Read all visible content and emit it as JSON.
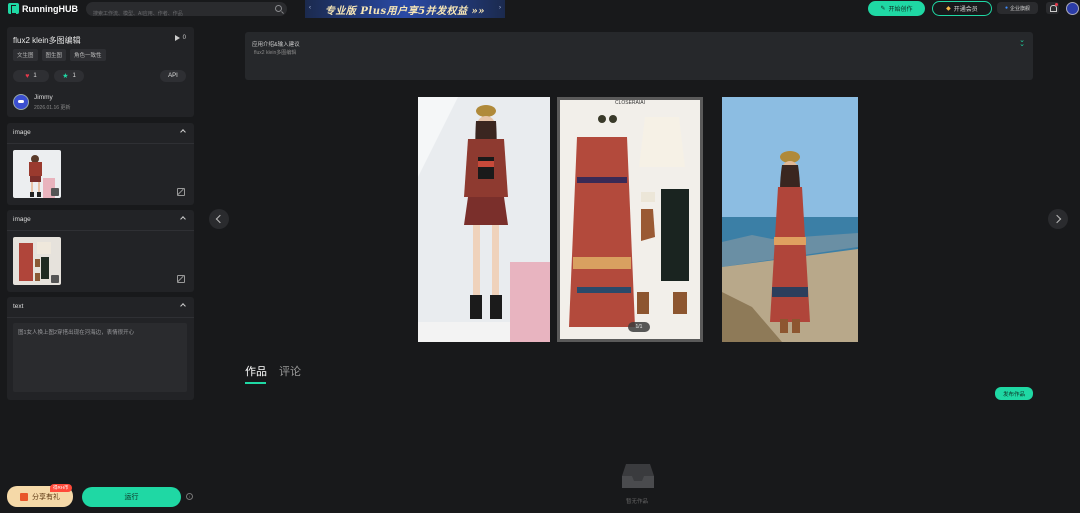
{
  "topbar": {
    "logo": "RunningHUB",
    "search_placeholder": "搜索工作流、模型、AI应用、作者、作品",
    "banner_text": "专业版 Plus用户享5并发权益 »»",
    "create_label": "开始创作",
    "vip_label": "开通会员",
    "enterprise_label": "企业旗舰"
  },
  "app": {
    "title": "flux2 klein多图编辑",
    "run_count": "0",
    "tags": [
      "文生图",
      "图生图",
      "角色一致性"
    ],
    "likes": "1",
    "favorites": "1",
    "api_label": "API",
    "author": "Jimmy",
    "date": "2026.01.16 更新"
  },
  "inputs": [
    {
      "label": "image"
    },
    {
      "label": "image"
    },
    {
      "label": "text",
      "value": "图1女人换上图2穿搭出现在河海边，表情很开心"
    }
  ],
  "footer": {
    "share_label": "分享有礼",
    "share_badge": "得RH币",
    "run_label": "运行",
    "info": "i"
  },
  "description": {
    "title": "应用介绍&输入建议",
    "subtitle": "flux2 klein多图编辑"
  },
  "gallery": {
    "page_indicator": "1/1",
    "collage_brand": "CLOSERAIAI"
  },
  "tabs": {
    "works": "作品",
    "comments": "评论"
  },
  "publish_label": "发布作品",
  "empty_text": "暂无作品",
  "colors": {
    "accent": "#1fd8a4",
    "background": "#18191b",
    "panel": "#222326"
  }
}
